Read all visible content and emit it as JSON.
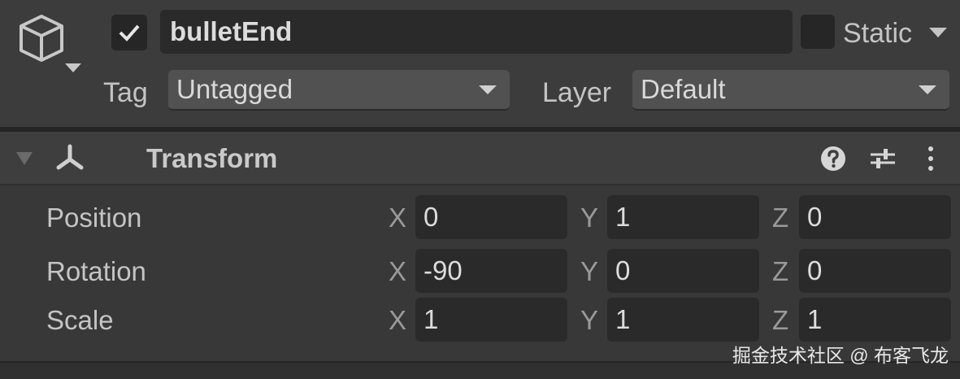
{
  "header": {
    "object_icon": "cube-icon",
    "active_checked": true,
    "name": "bulletEnd",
    "static_label": "Static",
    "static_checked": false,
    "tag_label": "Tag",
    "tag_value": "Untagged",
    "layer_label": "Layer",
    "layer_value": "Default"
  },
  "component": {
    "title": "Transform",
    "icons": [
      "transform-axes-icon",
      "help-icon",
      "preset-sliders-icon",
      "kebab-menu-icon"
    ]
  },
  "rows": [
    {
      "label": "Position",
      "x": "0",
      "y": "1",
      "z": "0"
    },
    {
      "label": "Rotation",
      "x": "-90",
      "y": "0",
      "z": "0"
    },
    {
      "label": "Scale",
      "x": "1",
      "y": "1",
      "z": "1"
    }
  ],
  "axes": {
    "x": "X",
    "y": "Y",
    "z": "Z"
  },
  "watermark": "掘金技术社区 @ 布客飞龙"
}
